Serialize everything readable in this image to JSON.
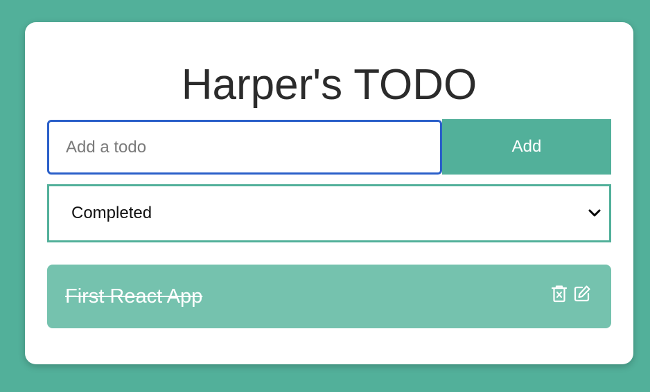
{
  "app": {
    "title": "Harper's TODO"
  },
  "form": {
    "input_placeholder": "Add a todo",
    "input_value": "",
    "add_label": "Add"
  },
  "filter": {
    "selected": "Completed",
    "options": [
      "Completed"
    ]
  },
  "todos": [
    {
      "text": "First React App",
      "completed": true,
      "actions": [
        "trash-icon",
        "edit-icon"
      ]
    }
  ],
  "colors": {
    "background": "#52b09a",
    "accent": "#52b09a",
    "item_background": "#75c2ae",
    "input_focus_border": "#2a5fc9",
    "title_text": "#2b2b2b"
  }
}
